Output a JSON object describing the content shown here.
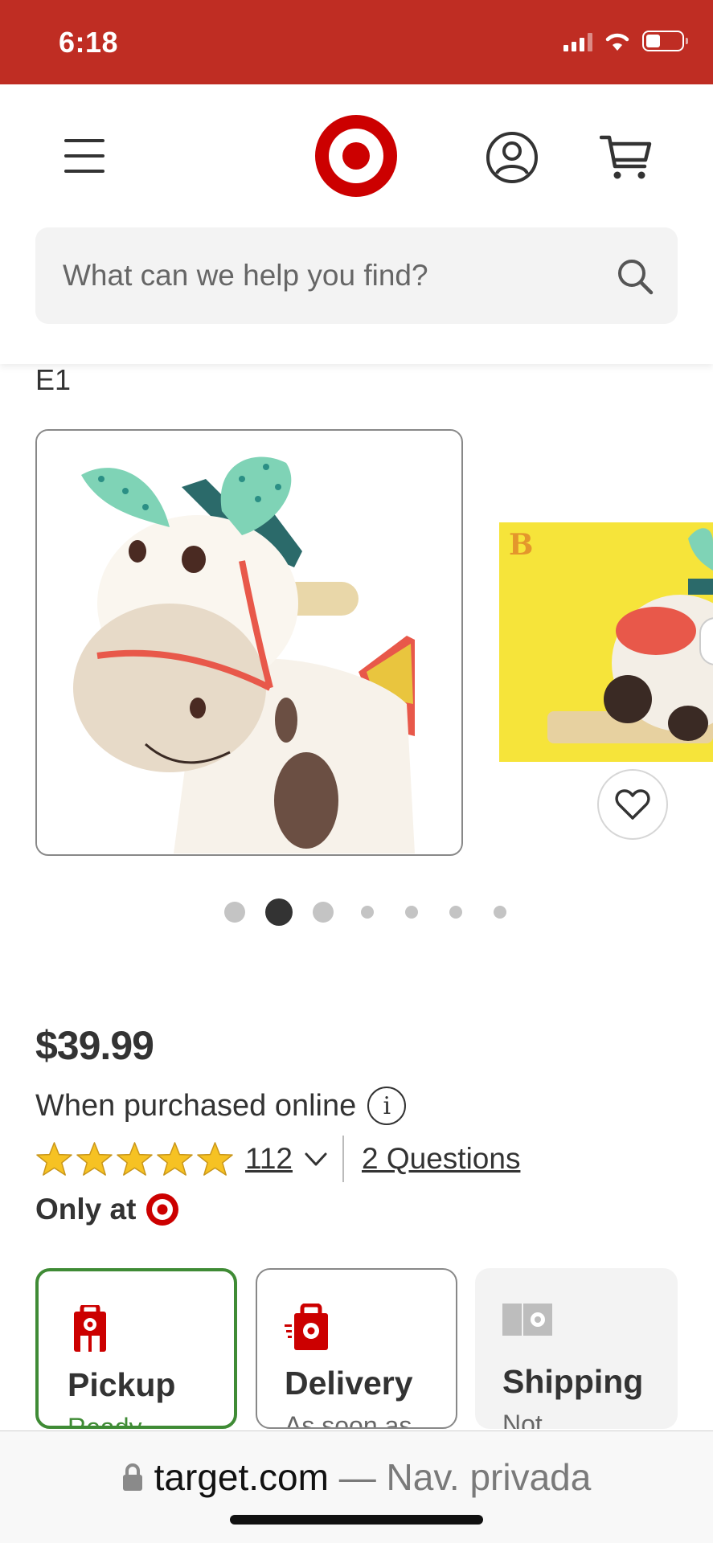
{
  "status_bar": {
    "time": "6:18"
  },
  "header": {
    "search": {
      "placeholder": "What can we help you find?"
    }
  },
  "breadcrumb": "E1",
  "carousel": {
    "total": 7,
    "active_index": 1
  },
  "product": {
    "price": "$39.99",
    "price_note": "When purchased online",
    "rating_stars": 5,
    "review_count": "112",
    "questions_link": "2 Questions",
    "only_at": "Only at"
  },
  "fulfillment": [
    {
      "title": "Pickup",
      "subtitle": "Ready",
      "selected": true
    },
    {
      "title": "Delivery",
      "subtitle": "As soon as",
      "selected": false
    },
    {
      "title": "Shipping",
      "subtitle": "Not",
      "selected": false
    }
  ],
  "browser": {
    "url": "target.com",
    "mode": "— Nav. privada"
  },
  "colors": {
    "brand_red": "#cc0000",
    "status_bar": "#bf2d23",
    "selected_green": "#3f8b35",
    "star_gold": "#f6c223"
  }
}
